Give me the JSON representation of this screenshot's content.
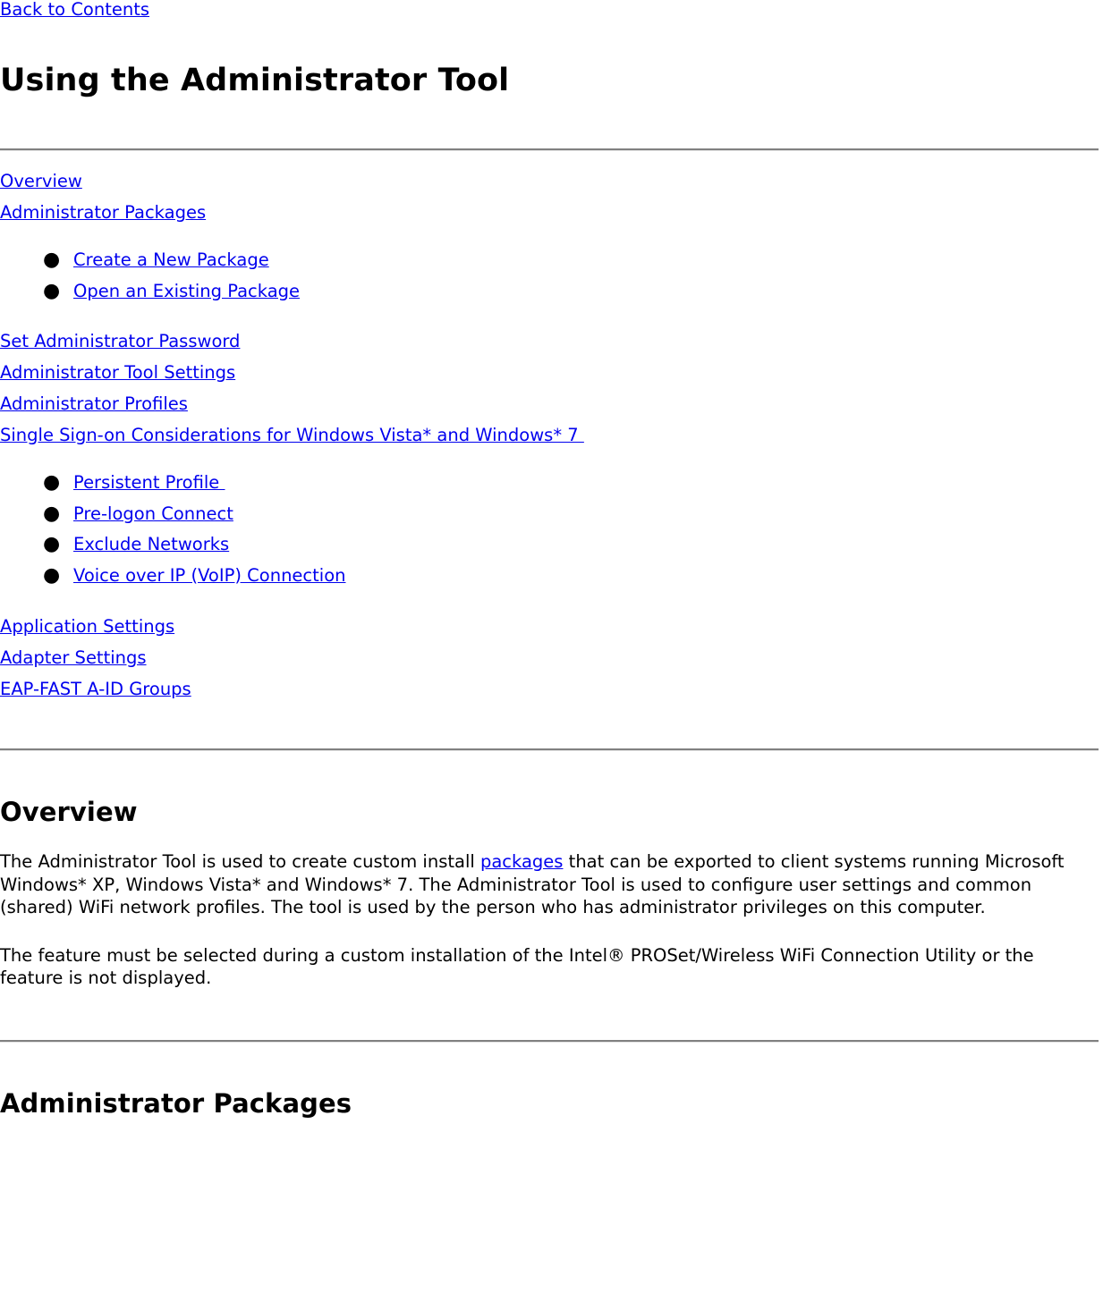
{
  "document": {
    "back_link": "Back to Contents",
    "title": "Using the Administrator Tool",
    "bullet_glyph": "●"
  },
  "toc": {
    "group1": [
      {
        "label": "Overview"
      },
      {
        "label": "Administrator Packages"
      }
    ],
    "list1": [
      {
        "label": "Create a New Package"
      },
      {
        "label": "Open an Existing Package"
      }
    ],
    "group2": [
      {
        "label": "Set Administrator Password"
      },
      {
        "label": "Administrator Tool Settings"
      },
      {
        "label": "Administrator Profiles"
      },
      {
        "label": "Single Sign-on Considerations for Windows Vista* and Windows* 7 "
      }
    ],
    "list2": [
      {
        "label": "Persistent Profile "
      },
      {
        "label": "Pre-logon Connect"
      },
      {
        "label": "Exclude Networks"
      },
      {
        "label": "Voice over IP (VoIP) Connection"
      }
    ],
    "group3": [
      {
        "label": "Application Settings"
      },
      {
        "label": "Adapter Settings"
      },
      {
        "label": "EAP-FAST A-ID Groups"
      }
    ]
  },
  "overview": {
    "heading": "Overview",
    "paragraph1_part1": "The Administrator Tool is used to create custom install ",
    "paragraph1_link": "packages",
    "paragraph1_part2": " that can be exported to client systems running Microsoft Windows* XP, Windows Vista* and Windows* 7. The Administrator Tool is used to configure user settings and common (shared) WiFi network profiles. The tool is used by the person who has administrator privileges on this computer.",
    "paragraph2": "The feature must be selected during a custom installation of the Intel® PROSet/Wireless WiFi Connection Utility or the feature is not displayed."
  },
  "packages_section": {
    "heading": "Administrator Packages"
  },
  "colors": {
    "link": "#0000EE",
    "text": "#000000",
    "rule_top": "#808080",
    "rule_bottom": "#E4E4E4",
    "background": "#FFFFFF"
  }
}
